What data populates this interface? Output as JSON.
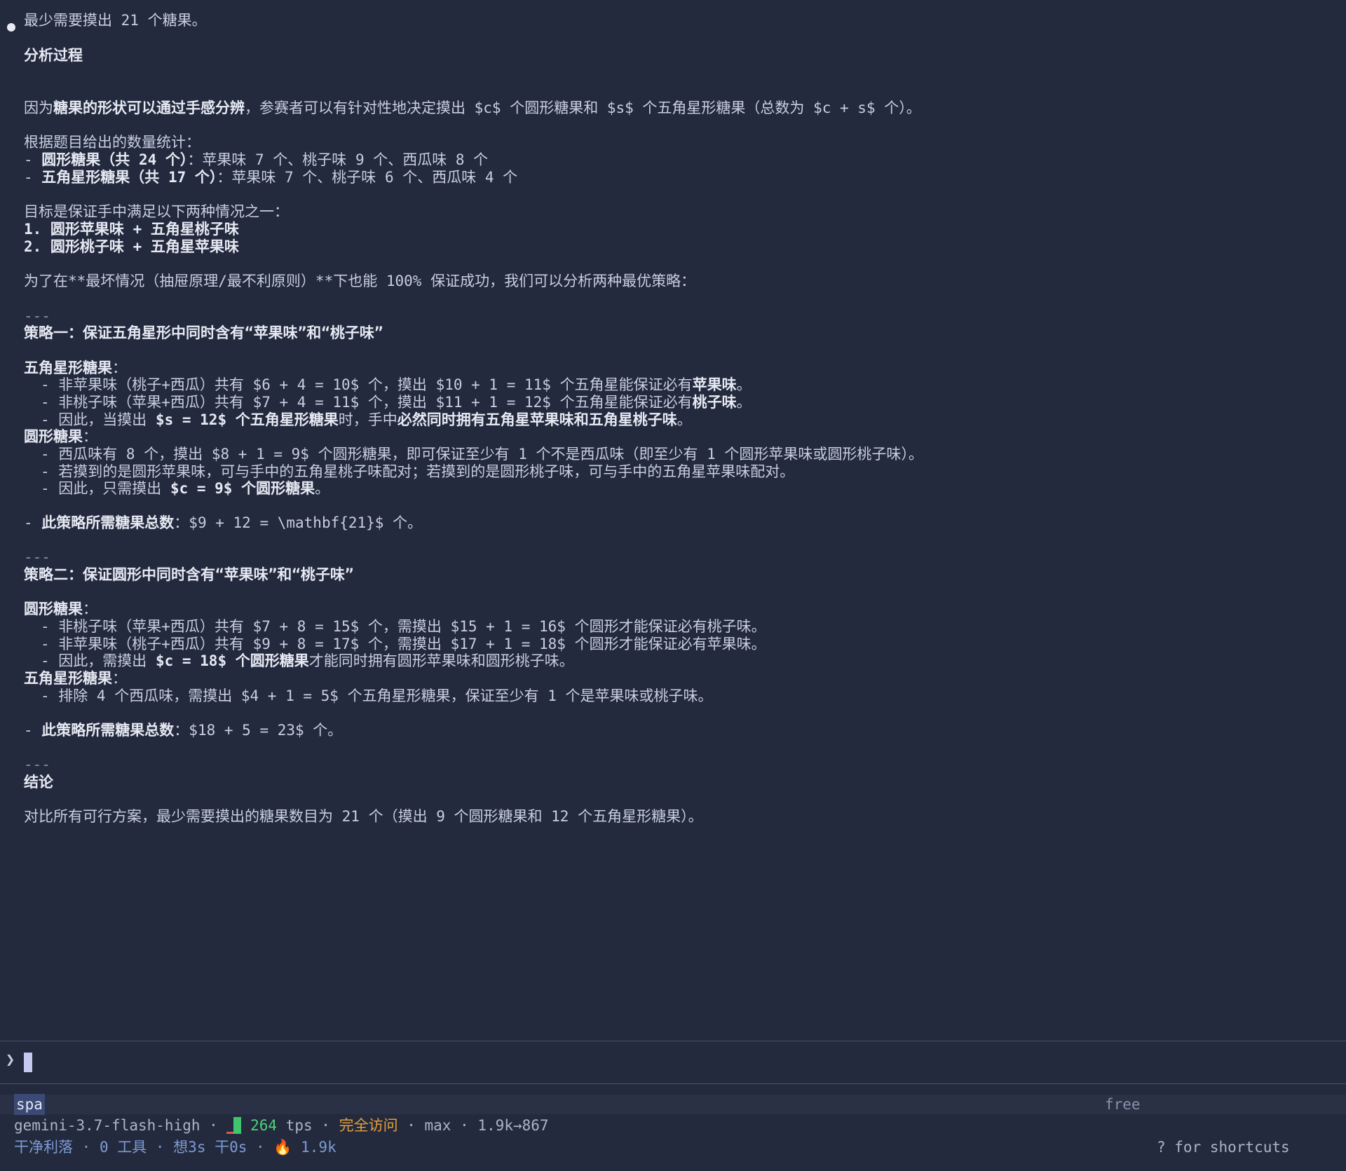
{
  "transcript": {
    "l1": "最少需要摸出 21 个糖果。",
    "h_analysis": "分析过程",
    "l3_pre": "因为",
    "l3_bold": "糖果的形状可以通过手感分辨",
    "l3_post": "，参赛者可以有针对性地决定摸出 $c$ 个圆形糖果和 $s$ 个五角星形糖果（总数为 $c + s$ 个）。",
    "l4": "根据题目给出的数量统计：",
    "l5_pre": "- ",
    "l5_bold": "圆形糖果（共 24 个）",
    "l5_post": "：苹果味 7 个、桃子味 9 个、西瓜味 8 个",
    "l6_pre": "- ",
    "l6_bold": "五角星形糖果（共 17 个）",
    "l6_post": "：苹果味 7 个、桃子味 6 个、西瓜味 4 个",
    "l7": "目标是保证手中满足以下两种情况之一：",
    "l8": "1. 圆形苹果味 + 五角星桃子味",
    "l9": "2. 圆形桃子味 + 五角星苹果味",
    "l10": "为了在**最坏情况（抽屉原理/最不利原则）**下也能 100% 保证成功，我们可以分析两种最优策略：",
    "sep1": "---",
    "s1_title": "策略一：保证五角星形中同时含有“苹果味”和“桃子味”",
    "s1_star_h": "五角星形糖果",
    "s1_colon": "：",
    "s1_a_pre": "- 非苹果味（桃子+西瓜）共有 $6 + 4 = 10$ 个，摸出 $10 + 1 = 11$ 个五角星能保证必有",
    "s1_a_bold": "苹果味",
    "s1_a_post": "。",
    "s1_b_pre": "- 非桃子味（苹果+西瓜）共有 $7 + 4 = 11$ 个，摸出 $11 + 1 = 12$ 个五角星能保证必有",
    "s1_b_bold": "桃子味",
    "s1_b_post": "。",
    "s1_c_pre": "- 因此，当摸出 ",
    "s1_c_bold": "$s = 12$ 个五角星形糖果",
    "s1_c_mid": "时，手中",
    "s1_c_bold2": "必然同时拥有五角星苹果味和五角星桃子味",
    "s1_c_post": "。",
    "s1_round_h": "圆形糖果",
    "s1_d": "- 西瓜味有 8 个，摸出 $8 + 1 = 9$ 个圆形糖果，即可保证至少有 1 个不是西瓜味（即至少有 1 个圆形苹果味或圆形桃子味）。",
    "s1_e": "- 若摸到的是圆形苹果味，可与手中的五角星桃子味配对；若摸到的是圆形桃子味，可与手中的五角星苹果味配对。",
    "s1_f_pre": "- 因此，只需摸出 ",
    "s1_f_bold": "$c = 9$ 个圆形糖果",
    "s1_f_post": "。",
    "s1_total_pre": "- ",
    "s1_total_bold": "此策略所需糖果总数",
    "s1_total_post": "：$9 + 12 = \\mathbf{21}$ 个。",
    "sep2": "---",
    "s2_title": "策略二：保证圆形中同时含有“苹果味”和“桃子味”",
    "s2_round_h": "圆形糖果",
    "s2_a": "- 非桃子味（苹果+西瓜）共有 $7 + 8 = 15$ 个，需摸出 $15 + 1 = 16$ 个圆形才能保证必有桃子味。",
    "s2_b": "- 非苹果味（桃子+西瓜）共有 $9 + 8 = 17$ 个，需摸出 $17 + 1 = 18$ 个圆形才能保证必有苹果味。",
    "s2_c_pre": "- 因此，需摸出 ",
    "s2_c_bold": "$c = 18$ 个圆形糖果",
    "s2_c_post": "才能同时拥有圆形苹果味和圆形桃子味。",
    "s2_star_h": "五角星形糖果",
    "s2_d": "- 排除 4 个西瓜味，需摸出 $4 + 1 = 5$ 个五角星形糖果，保证至少有 1 个是苹果味或桃子味。",
    "s2_total_pre": "- ",
    "s2_total_bold": "此策略所需糖果总数",
    "s2_total_post": "：$18 + 5 = 23$ 个。",
    "sep3": "---",
    "h_conclusion": "结论",
    "conclusion": "对比所有可行方案，最少需要摸出的糖果数目为 21 个（摸出 9 个圆形糖果和 12 个五角星形糖果）。"
  },
  "prompt": {
    "caret": "❯"
  },
  "status": {
    "mode": "spa",
    "plan": "free",
    "model": "gemini-3.7-flash-high",
    "sep": " · ",
    "tps_value": "264",
    "tps_unit": "tps",
    "access": "完全访问",
    "effort": "max",
    "tokens": "1.9k→867",
    "style": "干净利落",
    "tools": "0 工具",
    "think": "想3s 干0s",
    "flame_icon": "🔥",
    "flame_value": "1.9k",
    "shortcuts": "? for shortcuts"
  },
  "colors": {
    "background": "#232a3d",
    "text": "#c9cee0",
    "accent_green": "#3fc66d",
    "accent_orange": "#e7a13a",
    "accent_blue": "#7e9bd6"
  }
}
